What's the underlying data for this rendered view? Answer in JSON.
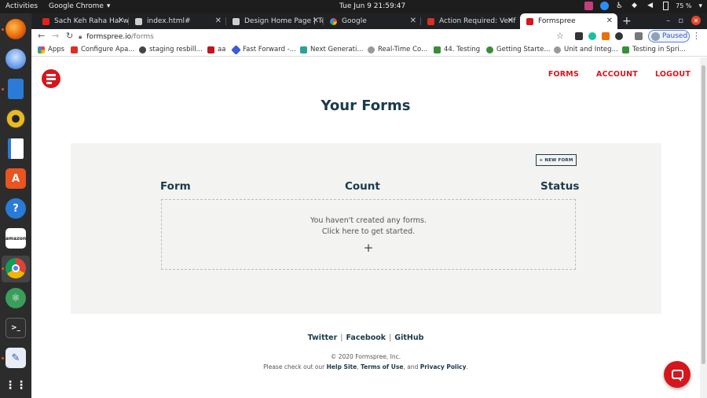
{
  "topbar": {
    "activities": "Activities",
    "app_name": "Google Chrome",
    "clock": "Tue Jun 9  21:59:47",
    "battery": "75 %"
  },
  "dock": {
    "apps": [
      "firefox",
      "thunderbird",
      "libreoffice-writer",
      "rhythmbox",
      "document-viewer",
      "ubuntu-software",
      "help",
      "amazon",
      "chrome",
      "atom",
      "terminal",
      "text-editor",
      "show-applications"
    ]
  },
  "tabs": [
    {
      "title": "Sach Keh Raha Hai with",
      "color": "#e62117"
    },
    {
      "title": "index.html#",
      "color": "#cfcfcf"
    },
    {
      "title": "Design Home Page | Te",
      "color": "#cfcfcf"
    },
    {
      "title": "Google",
      "color": "#4285f4"
    },
    {
      "title": "Action Required: Verif",
      "color": "#d93025"
    },
    {
      "title": "Formspree",
      "color": "#d6161d"
    }
  ],
  "address": {
    "host": "formspree.io",
    "path": "/forms",
    "profile_status": "Paused"
  },
  "bookmarks": [
    {
      "label": "Apps",
      "color": "#4285f4"
    },
    {
      "label": "Configure Apa...",
      "color": "#d93025"
    },
    {
      "label": "staging resbill...",
      "color": "#444444"
    },
    {
      "label": "aa",
      "color": "#c0161d"
    },
    {
      "label": "Fast Forward -...",
      "color": "#3b5bdb"
    },
    {
      "label": "Next Generati...",
      "color": "#2aa198"
    },
    {
      "label": "Real-Time Co...",
      "color": "#999999"
    },
    {
      "label": "44. Testing",
      "color": "#3a8e3a"
    },
    {
      "label": "Getting Starte...",
      "color": "#3a8e3a"
    },
    {
      "label": "Unit and Integ...",
      "color": "#999999"
    },
    {
      "label": "Testing in Spri...",
      "color": "#3a8e3a"
    }
  ],
  "page": {
    "nav": {
      "forms": "FORMS",
      "account": "ACCOUNT",
      "logout": "LOGOUT"
    },
    "title": "Your Forms",
    "new_form_label": "+ NEW FORM",
    "table_headers": {
      "form": "Form",
      "count": "Count",
      "status": "Status"
    },
    "empty_line1": "You haven't created any forms.",
    "empty_line2": "Click here to get started.",
    "plus": "+",
    "footer": {
      "twitter": "Twitter",
      "facebook": "Facebook",
      "github": "GitHub",
      "divider": "|"
    },
    "copyright": "© 2020 Formspree, Inc.",
    "policy_prefix": "Please check out our ",
    "help_site": "Help Site",
    "comma": ", ",
    "terms": "Terms of Use",
    "and": ", and ",
    "privacy": "Privacy Policy",
    "period": "."
  },
  "colors": {
    "brand": "#d6161d",
    "navy": "#1b3a4b"
  }
}
